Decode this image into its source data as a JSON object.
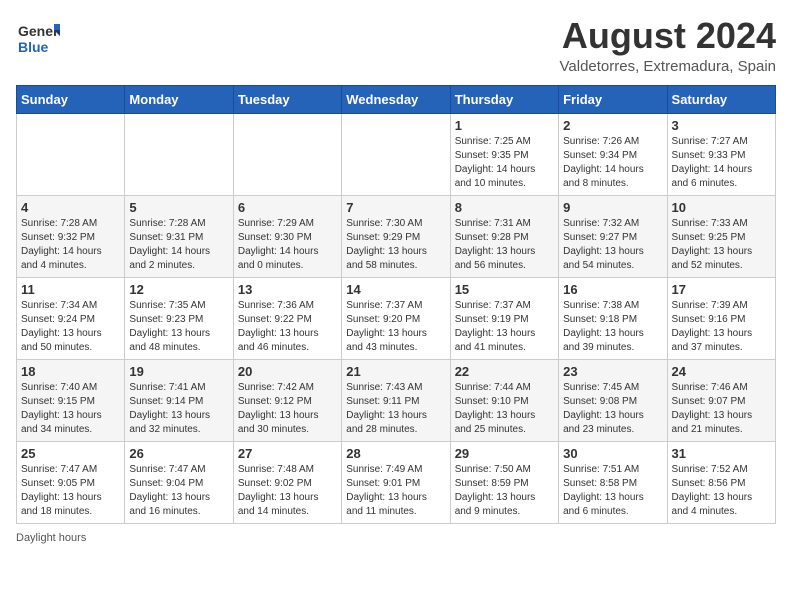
{
  "header": {
    "logo_general": "General",
    "logo_blue": "Blue",
    "title": "August 2024",
    "subtitle": "Valdetorres, Extremadura, Spain"
  },
  "days_of_week": [
    "Sunday",
    "Monday",
    "Tuesday",
    "Wednesday",
    "Thursday",
    "Friday",
    "Saturday"
  ],
  "weeks": [
    [
      {
        "day": "",
        "detail": ""
      },
      {
        "day": "",
        "detail": ""
      },
      {
        "day": "",
        "detail": ""
      },
      {
        "day": "",
        "detail": ""
      },
      {
        "day": "1",
        "detail": "Sunrise: 7:25 AM\nSunset: 9:35 PM\nDaylight: 14 hours and 10 minutes."
      },
      {
        "day": "2",
        "detail": "Sunrise: 7:26 AM\nSunset: 9:34 PM\nDaylight: 14 hours and 8 minutes."
      },
      {
        "day": "3",
        "detail": "Sunrise: 7:27 AM\nSunset: 9:33 PM\nDaylight: 14 hours and 6 minutes."
      }
    ],
    [
      {
        "day": "4",
        "detail": "Sunrise: 7:28 AM\nSunset: 9:32 PM\nDaylight: 14 hours and 4 minutes."
      },
      {
        "day": "5",
        "detail": "Sunrise: 7:28 AM\nSunset: 9:31 PM\nDaylight: 14 hours and 2 minutes."
      },
      {
        "day": "6",
        "detail": "Sunrise: 7:29 AM\nSunset: 9:30 PM\nDaylight: 14 hours and 0 minutes."
      },
      {
        "day": "7",
        "detail": "Sunrise: 7:30 AM\nSunset: 9:29 PM\nDaylight: 13 hours and 58 minutes."
      },
      {
        "day": "8",
        "detail": "Sunrise: 7:31 AM\nSunset: 9:28 PM\nDaylight: 13 hours and 56 minutes."
      },
      {
        "day": "9",
        "detail": "Sunrise: 7:32 AM\nSunset: 9:27 PM\nDaylight: 13 hours and 54 minutes."
      },
      {
        "day": "10",
        "detail": "Sunrise: 7:33 AM\nSunset: 9:25 PM\nDaylight: 13 hours and 52 minutes."
      }
    ],
    [
      {
        "day": "11",
        "detail": "Sunrise: 7:34 AM\nSunset: 9:24 PM\nDaylight: 13 hours and 50 minutes."
      },
      {
        "day": "12",
        "detail": "Sunrise: 7:35 AM\nSunset: 9:23 PM\nDaylight: 13 hours and 48 minutes."
      },
      {
        "day": "13",
        "detail": "Sunrise: 7:36 AM\nSunset: 9:22 PM\nDaylight: 13 hours and 46 minutes."
      },
      {
        "day": "14",
        "detail": "Sunrise: 7:37 AM\nSunset: 9:20 PM\nDaylight: 13 hours and 43 minutes."
      },
      {
        "day": "15",
        "detail": "Sunrise: 7:37 AM\nSunset: 9:19 PM\nDaylight: 13 hours and 41 minutes."
      },
      {
        "day": "16",
        "detail": "Sunrise: 7:38 AM\nSunset: 9:18 PM\nDaylight: 13 hours and 39 minutes."
      },
      {
        "day": "17",
        "detail": "Sunrise: 7:39 AM\nSunset: 9:16 PM\nDaylight: 13 hours and 37 minutes."
      }
    ],
    [
      {
        "day": "18",
        "detail": "Sunrise: 7:40 AM\nSunset: 9:15 PM\nDaylight: 13 hours and 34 minutes."
      },
      {
        "day": "19",
        "detail": "Sunrise: 7:41 AM\nSunset: 9:14 PM\nDaylight: 13 hours and 32 minutes."
      },
      {
        "day": "20",
        "detail": "Sunrise: 7:42 AM\nSunset: 9:12 PM\nDaylight: 13 hours and 30 minutes."
      },
      {
        "day": "21",
        "detail": "Sunrise: 7:43 AM\nSunset: 9:11 PM\nDaylight: 13 hours and 28 minutes."
      },
      {
        "day": "22",
        "detail": "Sunrise: 7:44 AM\nSunset: 9:10 PM\nDaylight: 13 hours and 25 minutes."
      },
      {
        "day": "23",
        "detail": "Sunrise: 7:45 AM\nSunset: 9:08 PM\nDaylight: 13 hours and 23 minutes."
      },
      {
        "day": "24",
        "detail": "Sunrise: 7:46 AM\nSunset: 9:07 PM\nDaylight: 13 hours and 21 minutes."
      }
    ],
    [
      {
        "day": "25",
        "detail": "Sunrise: 7:47 AM\nSunset: 9:05 PM\nDaylight: 13 hours and 18 minutes."
      },
      {
        "day": "26",
        "detail": "Sunrise: 7:47 AM\nSunset: 9:04 PM\nDaylight: 13 hours and 16 minutes."
      },
      {
        "day": "27",
        "detail": "Sunrise: 7:48 AM\nSunset: 9:02 PM\nDaylight: 13 hours and 14 minutes."
      },
      {
        "day": "28",
        "detail": "Sunrise: 7:49 AM\nSunset: 9:01 PM\nDaylight: 13 hours and 11 minutes."
      },
      {
        "day": "29",
        "detail": "Sunrise: 7:50 AM\nSunset: 8:59 PM\nDaylight: 13 hours and 9 minutes."
      },
      {
        "day": "30",
        "detail": "Sunrise: 7:51 AM\nSunset: 8:58 PM\nDaylight: 13 hours and 6 minutes."
      },
      {
        "day": "31",
        "detail": "Sunrise: 7:52 AM\nSunset: 8:56 PM\nDaylight: 13 hours and 4 minutes."
      }
    ]
  ],
  "footer": {
    "daylight_label": "Daylight hours"
  }
}
